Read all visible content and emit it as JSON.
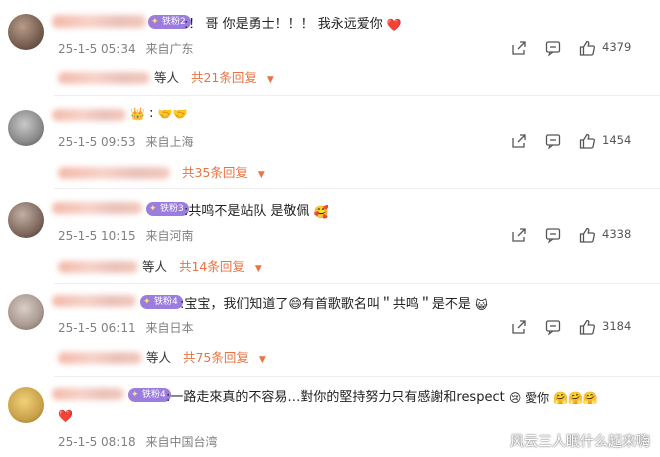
{
  "comments": [
    {
      "text": ":！ 哥 你是勇士！！！ 我永远爱你",
      "badge": "铁粉2",
      "trailing_emoji": "❤️",
      "time": "25-1-5 05:34",
      "location": "来自广东",
      "likes": "4379",
      "reply_suffix": "等人",
      "reply_more": "共21条回复"
    },
    {
      "text": ":",
      "trailing_emoji": "🤝🤝",
      "time": "25-1-5 09:53",
      "location": "来自上海",
      "likes": "1454",
      "reply_suffix": "",
      "reply_more": "共35条回复"
    },
    {
      "text": ":共鸣不是站队 是敬佩",
      "badge": "铁粉3",
      "trailing_emoji": "🥰",
      "time": "25-1-5 10:15",
      "location": "来自河南",
      "likes": "4338",
      "reply_suffix": "等人",
      "reply_more": "共14条回复"
    },
    {
      "text": ":宝宝，我们知道了😄有首歌歌名叫＂共鸣＂是不是",
      "badge": "铁粉4",
      "trailing_emoji": "😺",
      "time": "25-1-5 06:11",
      "location": "来自日本",
      "likes": "3184",
      "reply_suffix": "等人",
      "reply_more": "共75条回复"
    },
    {
      "text": ":一路走來真的不容易…對你的堅持努力只有感謝和respect",
      "badge": "铁粉4",
      "trailing_emoji": "😢 愛你 🤗🤗🤗",
      "second_line_emoji": "❤️",
      "time": "25-1-5 08:18",
      "location": "来自中国台湾",
      "likes": "",
      "reply_suffix": "",
      "reply_more": ""
    }
  ],
  "watermark": "风云三人眠什么起来嗨",
  "colors": {
    "accent": "#eb7340",
    "meta": "#808080",
    "badge": "#9b7de0"
  },
  "icons": [
    "share-icon",
    "comment-icon",
    "like-icon",
    "caret-down-icon"
  ]
}
